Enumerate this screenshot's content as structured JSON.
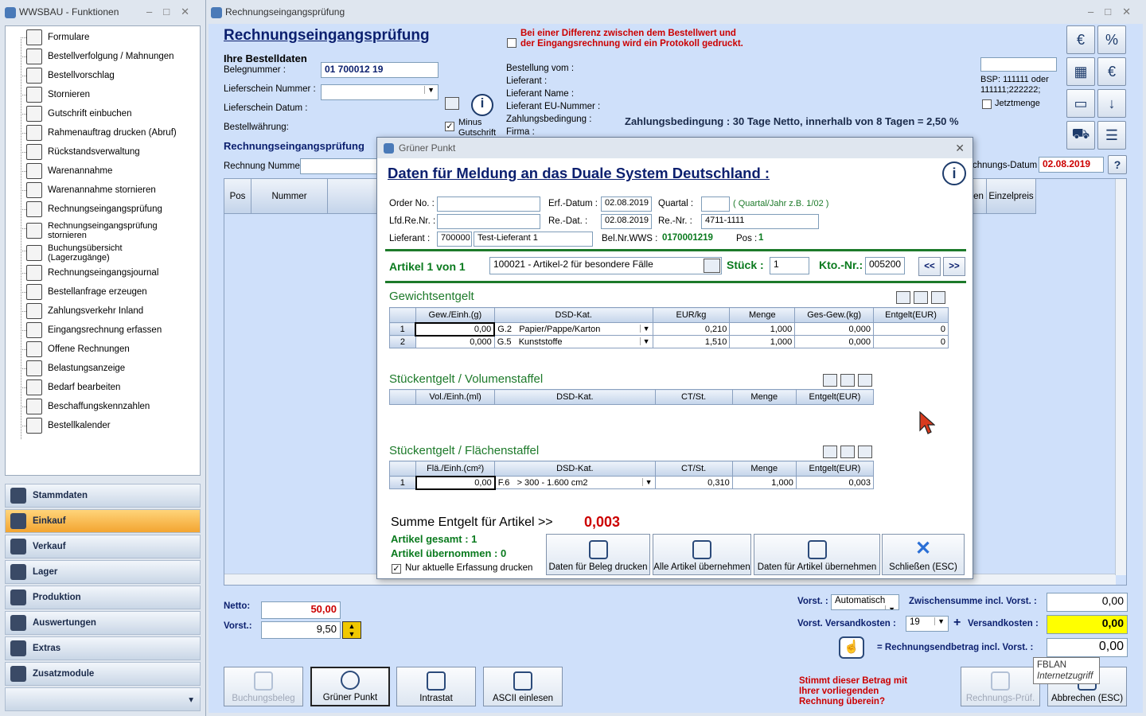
{
  "left_window": {
    "title": "WWSBAU - Funktionen",
    "tree": [
      "Formulare",
      "Bestellverfolgung / Mahnungen",
      "Bestellvorschlag",
      "Stornieren",
      "Gutschrift einbuchen",
      "Rahmenauftrag drucken (Abruf)",
      "Rückstandsverwaltung",
      "Warenannahme",
      "Warenannahme stornieren",
      "Rechnungseingangsprüfung",
      "Rechnungseingangsprüfung stornieren",
      "Buchungsübersicht (Lagerzugänge)",
      "Rechnungseingangsjournal",
      "Bestellanfrage erzeugen",
      "Zahlungsverkehr Inland",
      "Eingangsrechnung erfassen",
      "Offene Rechnungen",
      "Belastungsanzeige",
      "Bedarf bearbeiten",
      "Beschaffungskennzahlen",
      "Bestellkalender"
    ],
    "nav": [
      "Stammdaten",
      "Einkauf",
      "Verkauf",
      "Lager",
      "Produktion",
      "Auswertungen",
      "Extras",
      "Zusatzmodule"
    ],
    "active_nav": "Einkauf"
  },
  "main": {
    "title": "Rechnungseingangsprüfung",
    "heading": "Rechnungseingangsprüfung",
    "order_section": "Ihre Bestelldaten",
    "labels": {
      "belegnummer": "Belegnummer :",
      "lieferschein_nummer": "Lieferschein Nummer :",
      "lieferschein_datum": "Lieferschein Datum :",
      "bestellwaehrung": "Bestellwährung:",
      "subheading": "Rechnungseingangsprüfung",
      "rechnung_nummer": "Rechnung Nummer",
      "rechnungs_datum": "chnungs-Datum :",
      "bestellung_vom": "Bestellung vom :",
      "lieferant": "Lieferant :",
      "lieferant_name": "Lieferant Name :",
      "lieferant_eu": "Lieferant EU-Nummer :",
      "zahlungsbedingung": "Zahlungsbedingung :",
      "firma": "Firma :"
    },
    "belegnummer": "01 700012 19",
    "rechnungs_datum": "02.08.2019",
    "minus_gutschrift": "Minus Gutschrift",
    "protokoll_warning": "Bei einer Differenz zwischen dem Bestellwert und der Eingangsrechnung wird ein Protokoll gedruckt.",
    "zahlungsbedingung_text": "Zahlungsbedingung : 30 Tage Netto, innerhalb von 8 Tagen = 2,50 %",
    "bsp_hint": "BSP: 111111 oder 111111;222222;",
    "jetztmenge": "Jetztmenge",
    "grid_headers": [
      "Pos",
      "Nummer",
      "en",
      "Einzelpreis"
    ],
    "netto_label": "Netto:",
    "netto": "50,00",
    "vorst_label": "Vorst.:",
    "vorst": "9,50",
    "vorst_mode_label": "Vorst. :",
    "vorst_mode": "Automatisch",
    "zwischensumme_label": "Zwischensumme incl. Vorst. :",
    "zwischensumme": "0,00",
    "vorst_versand_label": "Vorst. Versandkosten :",
    "vorst_versand": "19",
    "versandkosten_label": "Versandkosten :",
    "versandkosten": "0,00",
    "endbetrag_label": "= Rechnungsendbetrag incl. Vorst. :",
    "endbetrag": "0,00",
    "stimmt_text": "Stimmt dieser Betrag mit Ihrer vorliegenden Rechnung überein?",
    "buttons": [
      "Buchungsbeleg",
      "Grüner Punkt",
      "Intrastat",
      "ASCII einlesen"
    ],
    "rechnungs_pruef": "Rechnungs-Prüf.",
    "abbrechen": "Abbrechen (ESC)",
    "tooltip_title": "FBLAN",
    "tooltip_sub": "Internetzugriff"
  },
  "dialog": {
    "title": "Grüner Punkt",
    "heading": "Daten für Meldung an das Duale System Deutschland :",
    "order_no_label": "Order No. :",
    "lfd_label": "Lfd.Re.Nr. :",
    "lieferant_label": "Lieferant :",
    "lieferant_nr": "700000",
    "lieferant_name": "Test-Lieferant 1",
    "erf_datum_label": "Erf.-Datum :",
    "erf_datum": "02.08.2019",
    "re_dat_label": "Re.-Dat. :",
    "re_dat": "02.08.2019",
    "belnr_label": "Bel.Nr.WWS :",
    "belnr": "0170001219",
    "pos_label": "Pos :",
    "pos": "1",
    "quartal_label": "Quartal :",
    "quartal_hint": "( Quartal/Jahr z.B. 1/02 )",
    "re_nr_label": "Re.-Nr. :",
    "re_nr": "4711-1111",
    "artikel_label": "Artikel 1 von 1",
    "artikel": "100021 - Artikel-2 für besondere Fälle",
    "stueck_label": "Stück :",
    "stueck": "1",
    "kto_label": "Kto.-Nr.:",
    "kto": "005200",
    "prev": "<<",
    "next": ">>",
    "gewicht_title": "Gewichtsentgelt",
    "gewicht_headers": [
      "Gew./Einh.(g)",
      "DSD-Kat.",
      "EUR/kg",
      "Menge",
      "Ges-Gew.(kg)",
      "Entgelt(EUR)"
    ],
    "gewicht_rows": [
      {
        "n": "1",
        "gew": "0,00",
        "kat_code": "G.2",
        "kat": "Papier/Pappe/Karton",
        "eur": "0,210",
        "menge": "1,000",
        "ges": "0,000",
        "entgelt": "0"
      },
      {
        "n": "2",
        "gew": "0,000",
        "kat_code": "G.5",
        "kat": "Kunststoffe",
        "eur": "1,510",
        "menge": "1,000",
        "ges": "0,000",
        "entgelt": "0"
      }
    ],
    "volumen_title": "Stückentgelt / Volumenstaffel",
    "volumen_headers": [
      "Vol./Einh.(ml)",
      "DSD-Kat.",
      "CT/St.",
      "Menge",
      "Entgelt(EUR)"
    ],
    "flaeche_title": "Stückentgelt / Flächenstaffel",
    "flaeche_headers": [
      "Flä./Einh.(cm²)",
      "DSD-Kat.",
      "CT/St.",
      "Menge",
      "Entgelt(EUR)"
    ],
    "flaeche_row": {
      "n": "1",
      "fl": "0,00",
      "kat_code": "F.6",
      "kat": "> 300 - 1.600 cm2",
      "ct": "0,310",
      "menge": "1,000",
      "entgelt": "0,003"
    },
    "summe_label": "Summe Entgelt für Artikel >>",
    "summe": "0,003",
    "artikel_gesamt": "Artikel gesamt : 1",
    "artikel_uebernommen": "Artikel übernommen : 0",
    "nur_aktuelle": "Nur aktuelle Erfassung drucken",
    "buttons": [
      "Daten für Beleg drucken",
      "Alle Artikel übernehmen",
      "Daten für Artikel übernehmen",
      "Schließen (ESC)"
    ]
  }
}
